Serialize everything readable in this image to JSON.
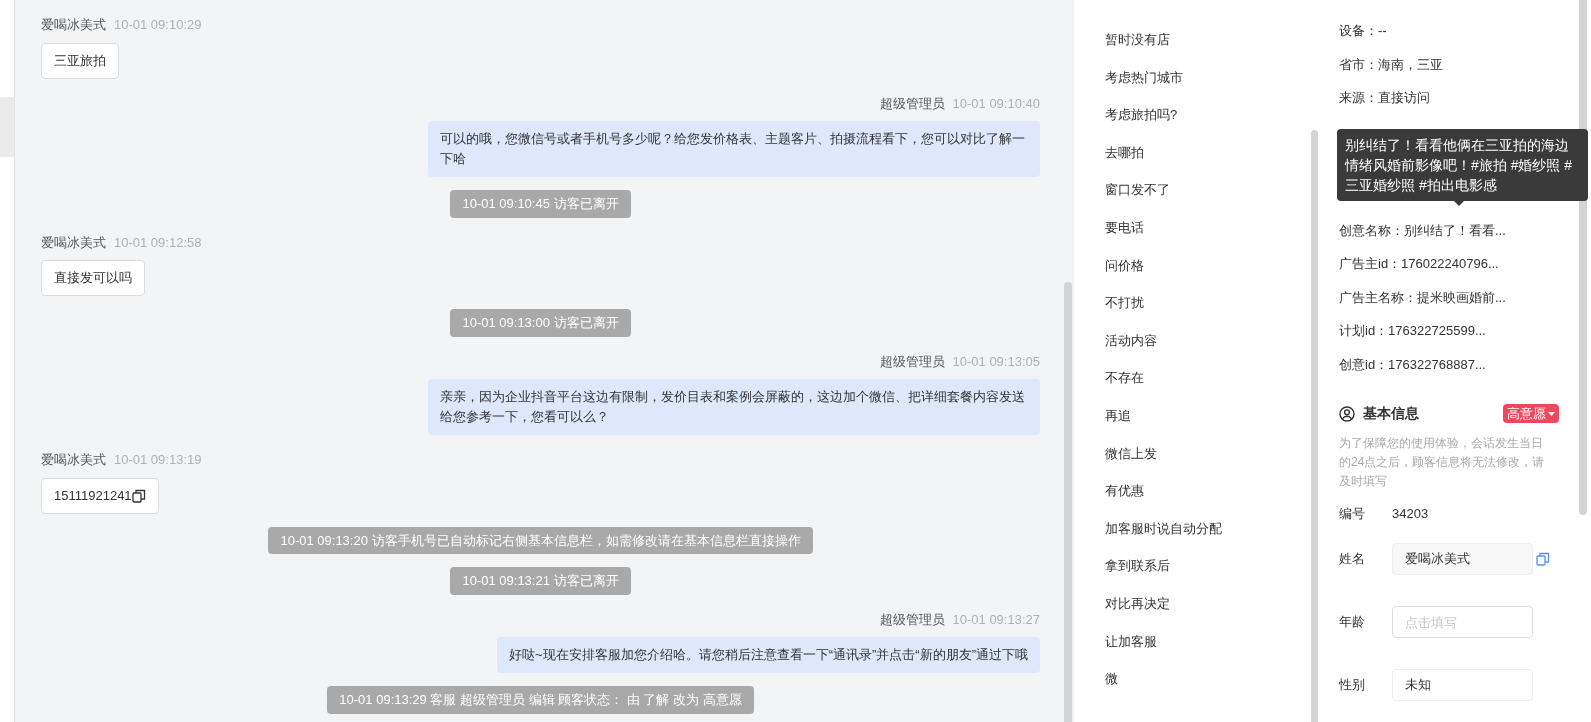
{
  "chat": {
    "messages": [
      {
        "kind": "visitor",
        "sender": "爱喝冰美式",
        "time": "10-01 09:10:29",
        "text": "三亚旅拍",
        "copyable": false
      },
      {
        "kind": "agent",
        "sender": "超级管理员",
        "time": "10-01 09:10:40",
        "text": "可以的哦，您微信号或者手机号多少呢？给您发价格表、主题客片、拍摄流程看下，您可以对比了解一下哈"
      },
      {
        "kind": "system",
        "text": "10-01 09:10:45 访客已离开"
      },
      {
        "kind": "visitor",
        "sender": "爱喝冰美式",
        "time": "10-01 09:12:58",
        "text": "直接发可以吗",
        "copyable": false
      },
      {
        "kind": "system",
        "text": "10-01 09:13:00 访客已离开"
      },
      {
        "kind": "agent",
        "sender": "超级管理员",
        "time": "10-01 09:13:05",
        "text": "亲亲，因为企业抖音平台这边有限制，发价目表和案例会屏蔽的，这边加个微信、把详细套餐内容发送给您参考一下，您看可以么？"
      },
      {
        "kind": "visitor",
        "sender": "爱喝冰美式",
        "time": "10-01 09:13:19",
        "text": "15111921241",
        "copyable": true
      },
      {
        "kind": "system",
        "text": "10-01 09:13:20 访客手机号已自动标记右侧基本信息栏，如需修改请在基本信息栏直接操作"
      },
      {
        "kind": "system",
        "text": "10-01 09:13:21 访客已离开"
      },
      {
        "kind": "agent",
        "sender": "超级管理员",
        "time": "10-01 09:13:27",
        "text": "好哒~现在安排客服加您介绍哈。请您稍后注意查看一下“通讯录”并点击“新的朋友”通过下哦"
      },
      {
        "kind": "system",
        "text": "10-01 09:13:29 客服 超级管理员 编辑 顾客状态： 由 了解 改为 高意愿"
      }
    ]
  },
  "quick_replies": [
    "暂时没有店",
    "考虑热门城市",
    "考虑旅拍吗?",
    "去哪拍",
    "窗口发不了",
    "要电话",
    "问价格",
    "不打扰",
    "活动内容",
    "不存在",
    "再追",
    "微信上发",
    "有优惠",
    "加客服时说自动分配",
    "拿到联系后",
    "对比再决定",
    "让加客服",
    "微"
  ],
  "visitor_info": {
    "fields": [
      {
        "text": "设备：--",
        "before_tooltip": true
      },
      {
        "text": "省市：海南，三亚",
        "before_tooltip": true
      },
      {
        "text": "来源：直接访问",
        "before_tooltip": true
      },
      {
        "text": "创意名称：别纠结了！看看...",
        "before_tooltip": false
      },
      {
        "text": "广告主id：176022240796...",
        "before_tooltip": false
      },
      {
        "text": "广告主名称：提米映画婚前...",
        "before_tooltip": false
      },
      {
        "text": "计划id：176322725599...",
        "before_tooltip": false
      },
      {
        "text": "创意id：176322768887...",
        "before_tooltip": false
      }
    ],
    "tooltip": "别纠结了！看看他俩在三亚拍的海边情绪风婚前影像吧！#旅拍 #婚纱照 #三亚婚纱照 #拍出电影感"
  },
  "basic_info": {
    "title": "基本信息",
    "intent": "高意愿",
    "note": "为了保障您的使用体验，会话发生当日的24点之后，顾客信息将无法修改，请及时填写",
    "rows": [
      {
        "kind": "text",
        "label": "编号",
        "value": "34203"
      },
      {
        "kind": "readonly",
        "label": "姓名",
        "value": "爱喝冰美式",
        "copyable": true
      },
      {
        "kind": "input",
        "label": "年龄",
        "placeholder": "点击填写"
      },
      {
        "kind": "select",
        "label": "性别",
        "value": "未知"
      }
    ]
  }
}
